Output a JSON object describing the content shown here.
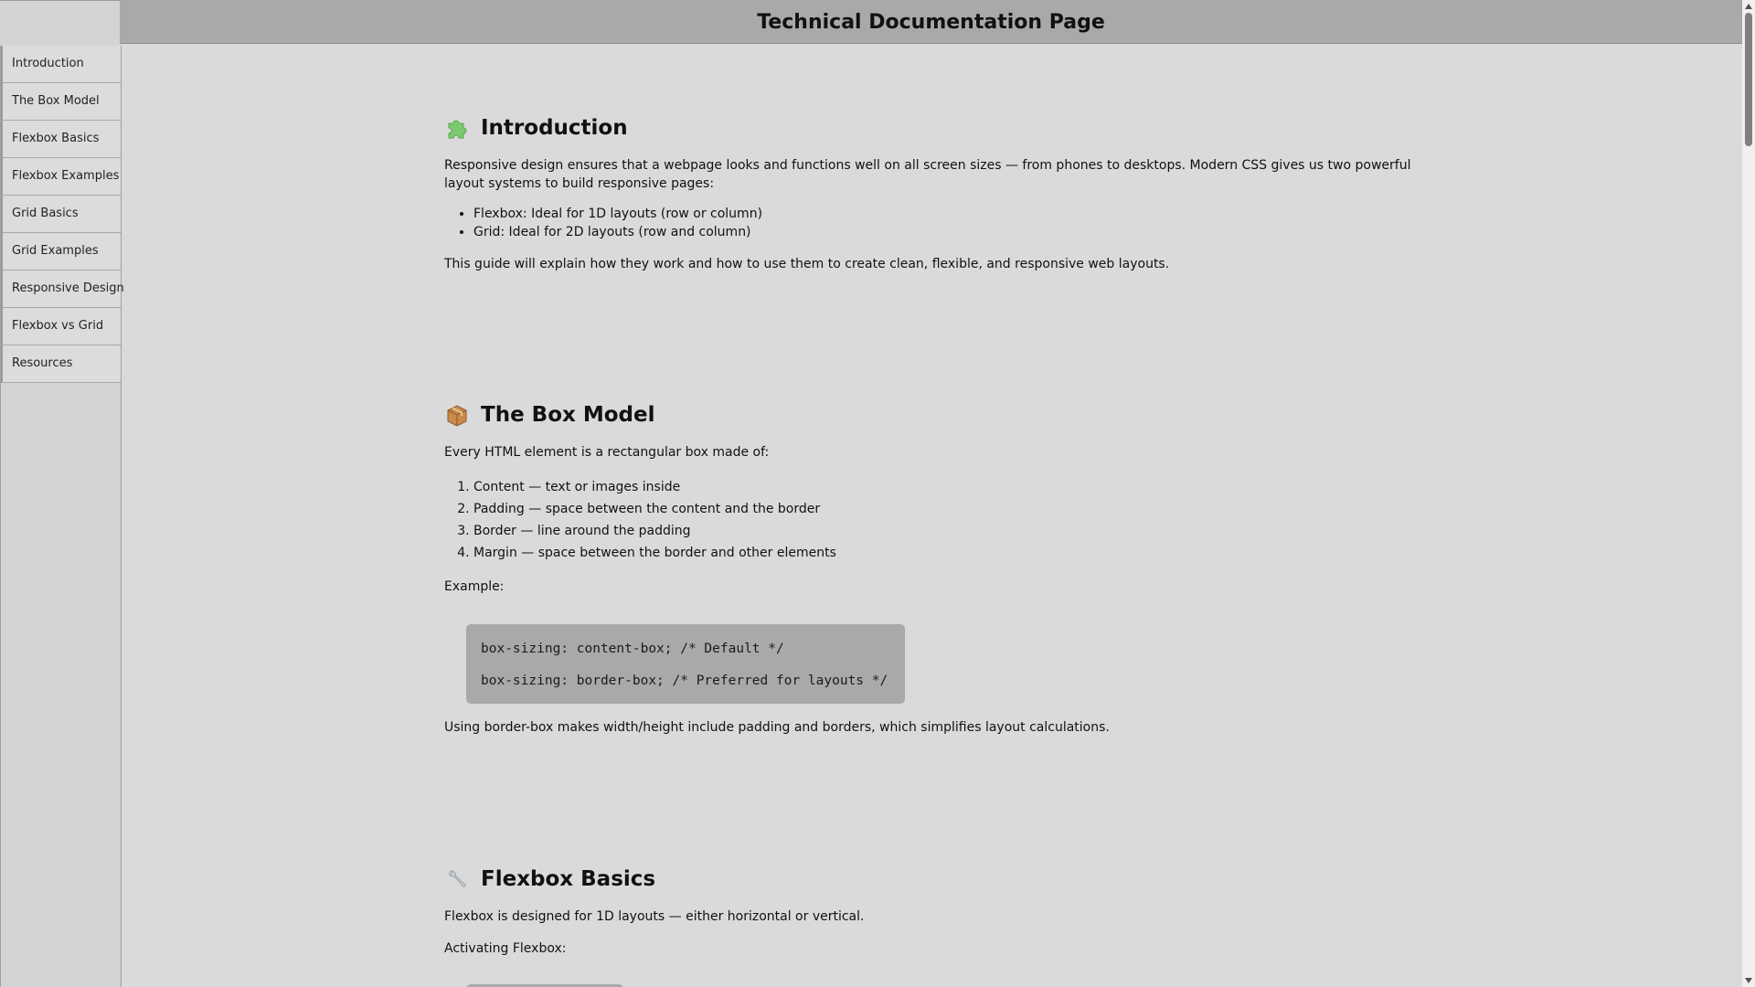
{
  "header": {
    "title": "Technical Documentation Page"
  },
  "sidebar": {
    "items": [
      {
        "label": "Introduction"
      },
      {
        "label": "The Box Model"
      },
      {
        "label": "Flexbox Basics"
      },
      {
        "label": "Flexbox Examples"
      },
      {
        "label": "Grid Basics"
      },
      {
        "label": "Grid Examples"
      },
      {
        "label": "Responsive Design"
      },
      {
        "label": "Flexbox vs Grid"
      },
      {
        "label": "Resources"
      }
    ]
  },
  "sections": {
    "intro": {
      "icon": "puzzle-piece-icon",
      "heading": "Introduction",
      "p1": "Responsive design ensures that a webpage looks and functions well on all screen sizes — from phones to desktops. Modern CSS gives us two powerful layout systems to build responsive pages:",
      "list": [
        "Flexbox: Ideal for 1D layouts (row or column)",
        "Grid: Ideal for 2D layouts (row and column)"
      ],
      "p2": "This guide will explain how they work and how to use them to create clean, flexible, and responsive web layouts."
    },
    "box_model": {
      "icon": "package-box-icon",
      "heading": "The Box Model",
      "p1": "Every HTML element is a rectangular box made of:",
      "list": [
        "Content — text or images inside",
        "Padding — space between the content and the border",
        "Border — line around the padding",
        "Margin — space between the border and other elements"
      ],
      "example_label": "Example:",
      "code": [
        "box-sizing: content-box; /* Default */",
        "box-sizing: border-box; /* Preferred for layouts */"
      ],
      "p2": "Using border-box makes width/height include padding and borders, which simplifies layout calculations."
    },
    "flexbox_basics": {
      "icon": "wrench-icon",
      "heading": "Flexbox Basics",
      "p1": "Flexbox is designed for 1D layouts — either horizontal or vertical.",
      "p2": "Activating Flexbox:"
    }
  }
}
